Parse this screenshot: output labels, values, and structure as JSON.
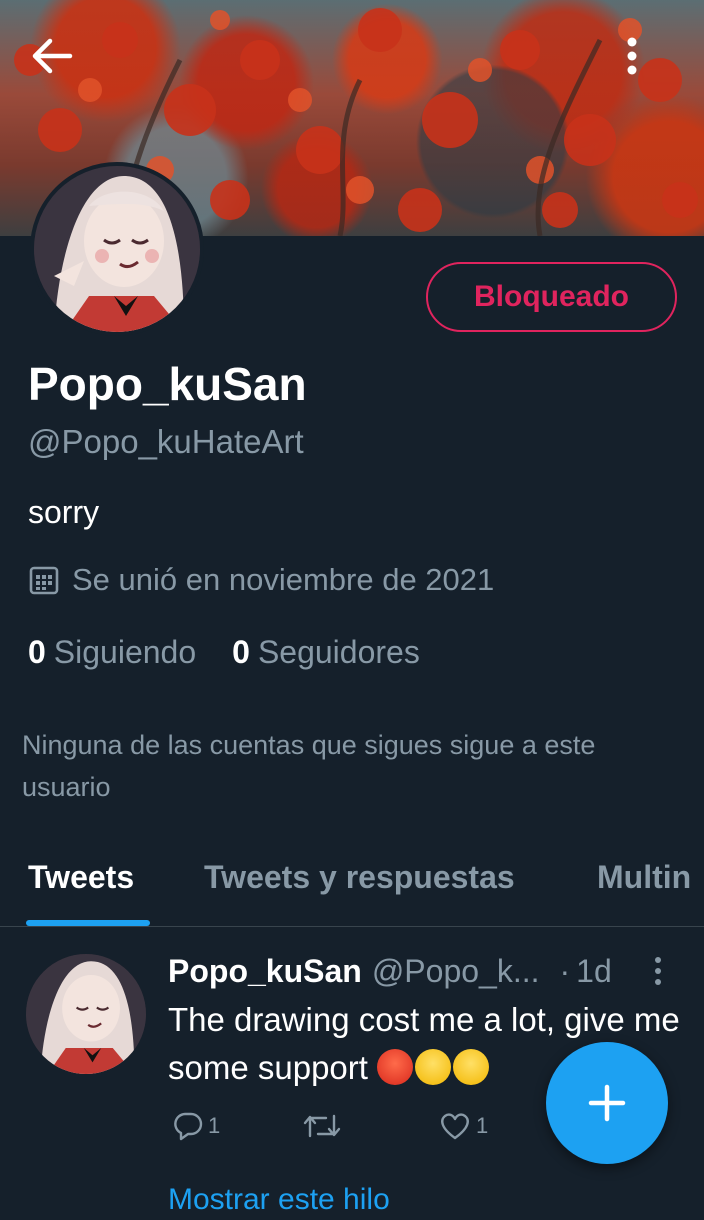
{
  "profile": {
    "display_name": "Popo_kuSan",
    "handle": "@Popo_kuHateArt",
    "bio": "sorry",
    "joined": "Se unió en noviembre de 2021",
    "following_count": "0",
    "following_label": "Siguiendo",
    "followers_count": "0",
    "followers_label": "Seguidores",
    "not_followed_note": "Ninguna de las cuentas que sigues sigue a este usuario",
    "blocked_label": "Bloqueado"
  },
  "tabs": [
    {
      "label": "Tweets",
      "active": true
    },
    {
      "label": "Tweets y respuestas",
      "active": false
    },
    {
      "label": "Multin",
      "active": false
    }
  ],
  "tweet": {
    "name": "Popo_kuSan",
    "handle": "@Popo_k...",
    "separator": "·",
    "time": "1d",
    "text": "The drawing cost me a lot, give me some support",
    "reply_count": "1",
    "like_count": "1",
    "show_thread": "Mostrar este hilo"
  },
  "icons": {
    "back": "arrow-left-icon",
    "more": "vertical-dots-icon",
    "calendar": "calendar-icon",
    "reply": "speech-bubble-icon",
    "retweet": "retweet-icon",
    "like": "heart-icon",
    "compose": "plus-icon"
  },
  "colors": {
    "background": "#15202b",
    "accent": "#1da1f2",
    "blocked": "#e0245e",
    "secondary_text": "#8899a6"
  }
}
